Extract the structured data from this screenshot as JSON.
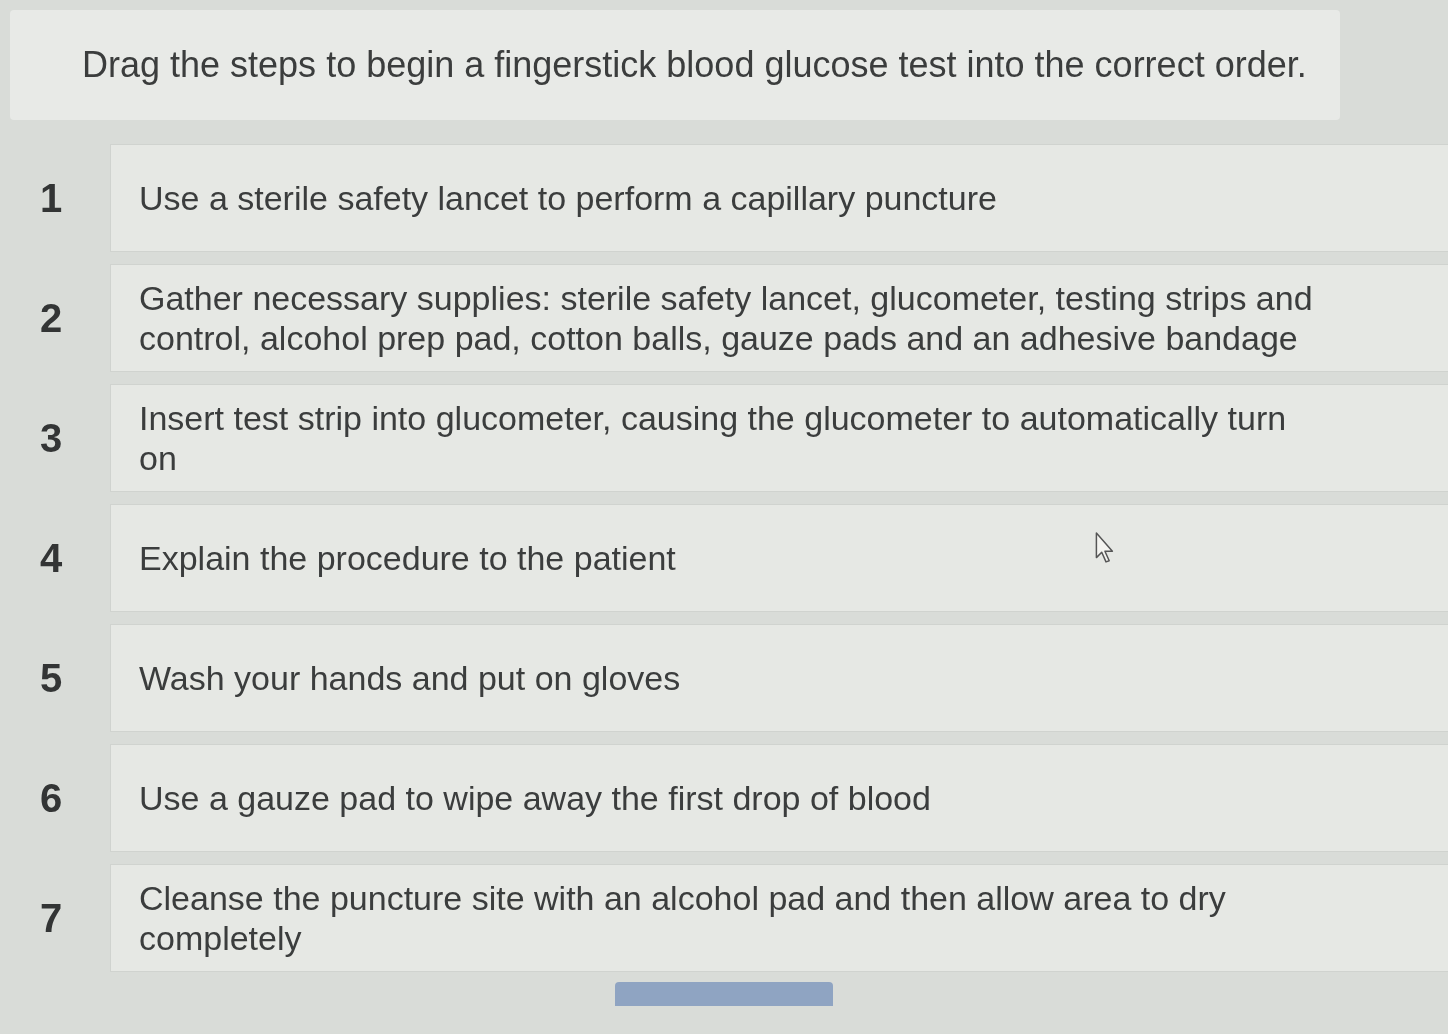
{
  "instruction": "Drag the steps to begin a fingerstick blood glucose test into the correct order.",
  "steps": [
    {
      "number": "1",
      "text": "Use a sterile safety lancet to perform a capillary puncture"
    },
    {
      "number": "2",
      "text": "Gather necessary supplies: sterile safety lancet, glucometer, testing strips and control, alcohol prep pad, cotton balls, gauze pads and an adhesive bandage"
    },
    {
      "number": "3",
      "text": "Insert test strip into glucometer, causing the glucometer to automatically turn on"
    },
    {
      "number": "4",
      "text": "Explain the procedure to the patient"
    },
    {
      "number": "5",
      "text": "Wash your hands and put on gloves"
    },
    {
      "number": "6",
      "text": "Use a gauze pad to wipe away the first drop of blood"
    },
    {
      "number": "7",
      "text": "Cleanse the puncture site with an alcohol pad and then allow area to dry completely"
    }
  ]
}
